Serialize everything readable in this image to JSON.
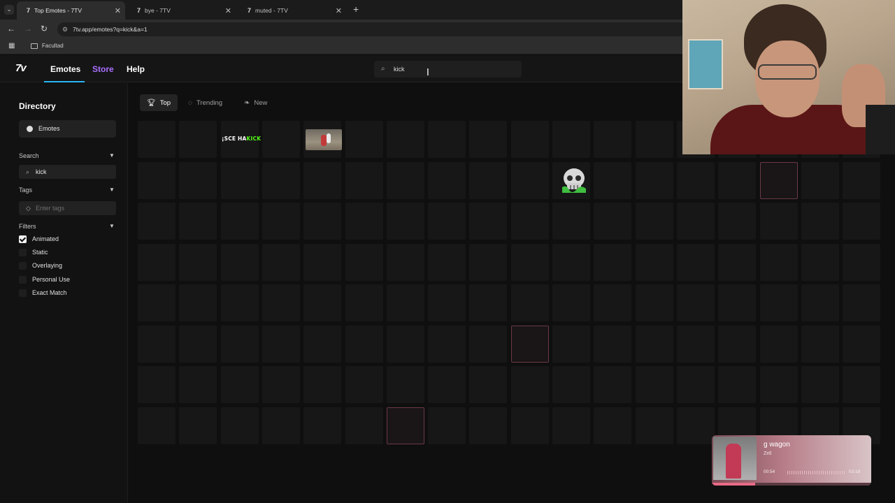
{
  "browser": {
    "tabs": [
      {
        "title": "Top Emotes - 7TV",
        "active": true
      },
      {
        "title": "bye - 7TV",
        "active": false
      },
      {
        "title": "muted - 7TV",
        "active": false
      }
    ],
    "url": "7tv.app/emotes?q=kick&a=1",
    "bookmarks": [
      {
        "label": "Facultad"
      }
    ]
  },
  "header": {
    "logo": "7v",
    "nav": {
      "emotes": "Emotes",
      "store": "Store",
      "help": "Help"
    },
    "search_value": "kick"
  },
  "sidebar": {
    "title": "Directory",
    "directory_item": "Emotes",
    "search_label": "Search",
    "search_value": "kick",
    "tags_label": "Tags",
    "tags_placeholder": "Enter tags",
    "filters_label": "Filters",
    "filters": [
      {
        "label": "Animated",
        "checked": true
      },
      {
        "label": "Static",
        "checked": false
      },
      {
        "label": "Overlaying",
        "checked": false
      },
      {
        "label": "Personal Use",
        "checked": false
      },
      {
        "label": "Exact Match",
        "checked": false
      }
    ]
  },
  "content_tabs": {
    "top": "Top",
    "trending": "Trending",
    "new": "New"
  },
  "emotes": {
    "kick_text_a": "¡SCE HA",
    "kick_text_b": "KICK"
  },
  "music": {
    "title": "g wagon",
    "artist": "Zell",
    "current_time": "00:54",
    "duration": "03:18",
    "progress_fraction": 0.27
  },
  "colors": {
    "accent": "#29b6f6",
    "store": "#a970ff",
    "kick_green": "#53fc18"
  }
}
